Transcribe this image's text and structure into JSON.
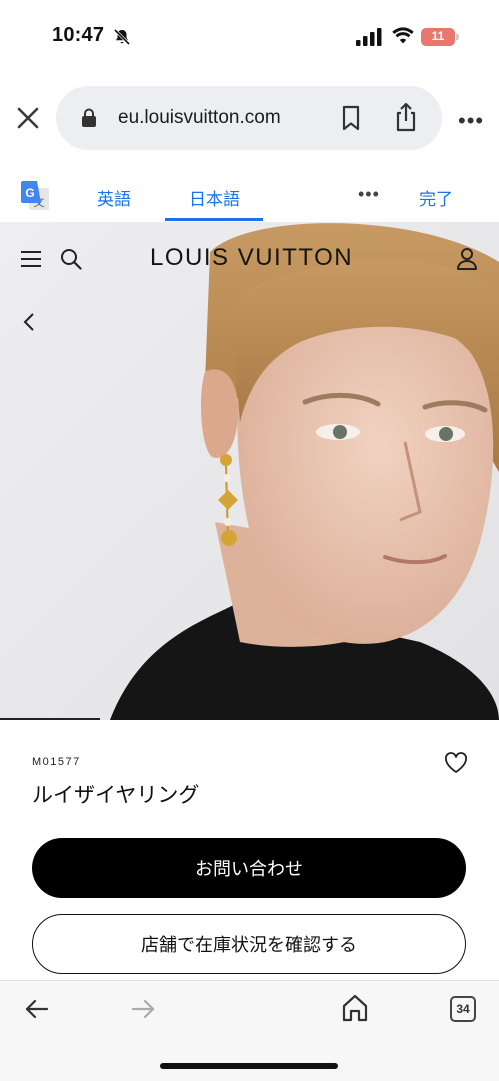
{
  "status_bar": {
    "time": "10:47",
    "battery": "11"
  },
  "browser": {
    "url": "eu.louisvuitton.com",
    "icons": [
      "close-icon",
      "lock-icon",
      "bookmark-icon",
      "share-icon",
      "more-icon"
    ]
  },
  "translate_bar": {
    "source_language": "英語",
    "target_language": "日本語",
    "more": "•••",
    "done": "完了"
  },
  "site_header": {
    "brand": "LOUIS VUITTON",
    "icons": [
      "menu-icon",
      "search-icon",
      "account-icon",
      "back-chevron-icon"
    ]
  },
  "product": {
    "sku": "M01577",
    "name": "ルイザイヤリング",
    "primary_button": "お問い合わせ",
    "secondary_button": "店舗で在庫状況を確認する",
    "image_index_fraction": 0.2
  },
  "bottom_toolbar": {
    "tab_count": "34",
    "icons": [
      "back-arrow-icon",
      "forward-arrow-icon",
      "home-icon",
      "tabs-icon"
    ]
  },
  "colors": {
    "link_blue": "#1a73e8",
    "battery_red": "#e8776d",
    "button_black": "#000000",
    "url_bar_bg": "#eceef1"
  }
}
